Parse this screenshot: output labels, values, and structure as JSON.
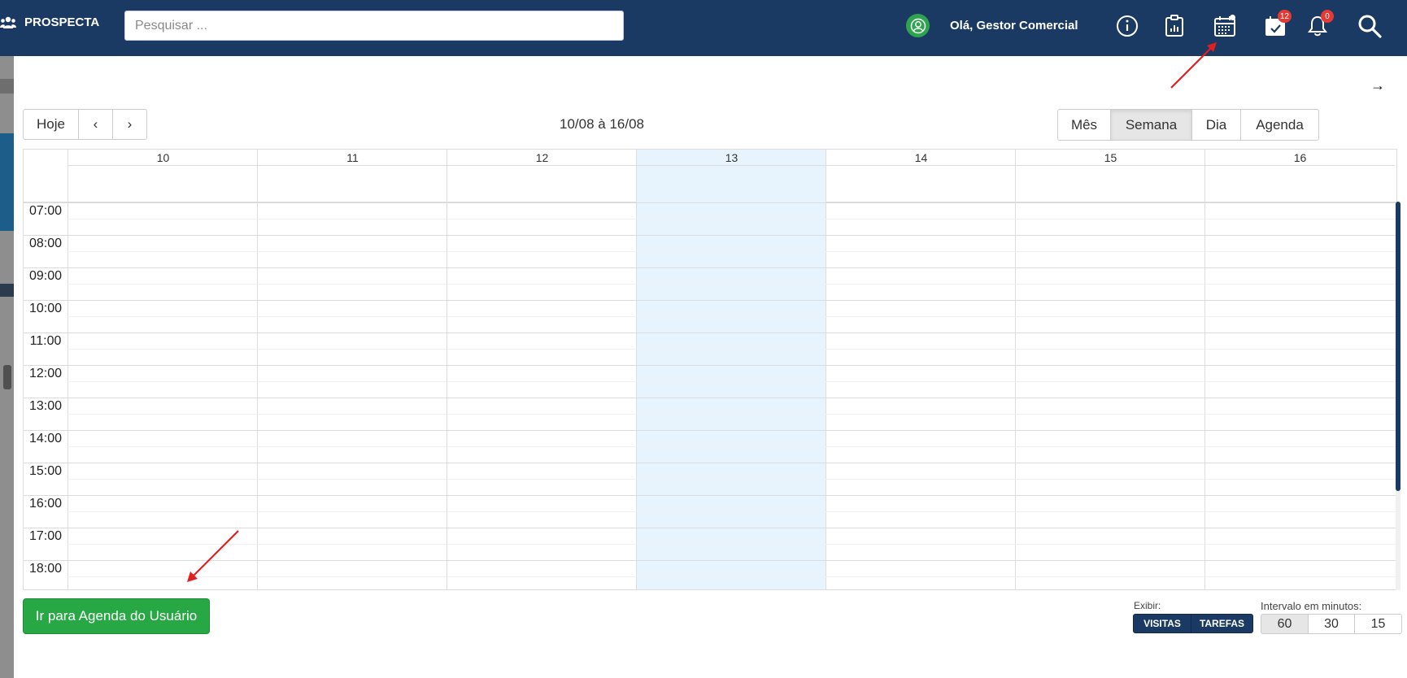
{
  "topbar": {
    "brand": "PROSPECTA",
    "search_placeholder": "Pesquisar ...",
    "greeting": "Olá, Gestor Comercial",
    "tasks_badge": "12",
    "notifications_badge": "0"
  },
  "calendar": {
    "range_title": "10/08 à 16/08",
    "today_label": "Hoje",
    "prev_label": "‹",
    "next_label": "›",
    "views": [
      "Mês",
      "Semana",
      "Dia",
      "Agenda"
    ],
    "active_view": "Semana",
    "days": [
      "10",
      "11",
      "12",
      "13",
      "14",
      "15",
      "16"
    ],
    "today_day": "13",
    "hours": [
      "07:00",
      "08:00",
      "09:00",
      "10:00",
      "11:00",
      "12:00",
      "13:00",
      "14:00",
      "15:00",
      "16:00",
      "17:00",
      "18:00"
    ]
  },
  "footer": {
    "go_button": "Ir para Agenda do Usuário",
    "exibir_label": "Exibir:",
    "visitas_label": "VISITAS",
    "tarefas_label": "TAREFAS",
    "interval_label": "Intervalo em minutos:",
    "intervals": [
      "60",
      "30",
      "15"
    ],
    "active_interval": "60"
  },
  "colors": {
    "topbar": "#1b3a63",
    "today_column": "#e8f4fd",
    "go_button": "#28a745",
    "badge": "#e53935",
    "arrow": "#e02020"
  }
}
